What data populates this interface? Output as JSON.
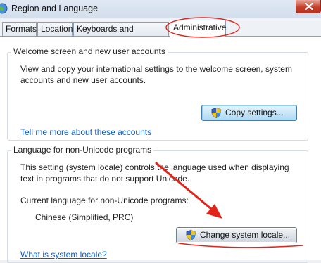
{
  "window": {
    "title": "Region and Language",
    "close_icon": "close-icon"
  },
  "tabs": [
    {
      "label": "Formats",
      "active": false
    },
    {
      "label": "Location",
      "active": false
    },
    {
      "label": "Keyboards and Languages",
      "active": false
    },
    {
      "label": "Administrative",
      "active": true
    }
  ],
  "welcome_group": {
    "title": "Welcome screen and new user accounts",
    "description_line1": "View and copy your international settings to the welcome screen, system",
    "description_line2": "accounts and new user accounts.",
    "copy_button_label": "Copy settings...",
    "link": "Tell me more about these accounts"
  },
  "unicode_group": {
    "title": "Language for non-Unicode programs",
    "description_line1": "This setting (system locale) controls the language used when displaying",
    "description_line2": "text in programs that do not support Unicode.",
    "current_label": "Current language for non-Unicode programs:",
    "current_value": "Chinese (Simplified, PRC)",
    "change_button_label": "Change system locale...",
    "link": "What is system locale?"
  },
  "annotations": {
    "color": "#e2231a",
    "highlight": "ellipse-around-administrative-tab",
    "arrow": "arrow-pointing-to-change-system-locale-button",
    "underline": "underline-below-change-system-locale-button"
  },
  "colors": {
    "link": "#0a5bc4",
    "window_frame": "#d3deec",
    "close_button": "#c6402b"
  }
}
